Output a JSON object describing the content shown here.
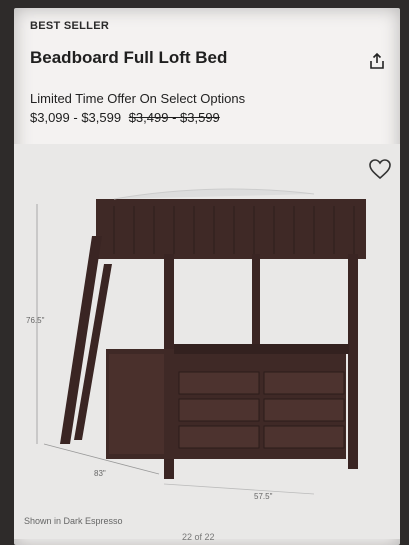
{
  "product": {
    "badge": "BEST SELLER",
    "title": "Beadboard Full Loft Bed",
    "offer_text": "Limited Time Offer On Select Options",
    "price_sale": "$3,099 - $3,599",
    "price_original": "$3,499 - $3,599"
  },
  "image": {
    "dim_height": "76.5\"",
    "dim_width": "83\"",
    "dim_depth": "57.5\"",
    "caption": "Shown in Dark Espresso",
    "pager": "22 of 22"
  },
  "icons": {
    "share": "share-icon",
    "favorite": "heart-icon"
  },
  "colors": {
    "wood": "#3f2926",
    "background": "#f4f2f1"
  }
}
